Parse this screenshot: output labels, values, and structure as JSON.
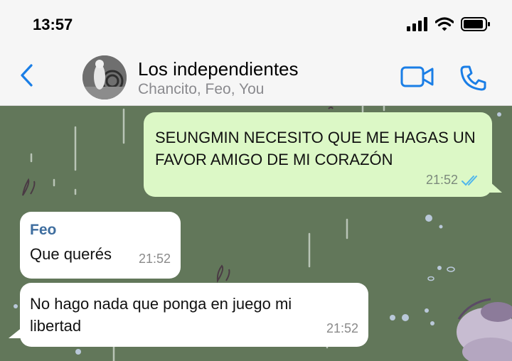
{
  "status": {
    "time": "13:57"
  },
  "header": {
    "back_icon": "chevron-left-icon",
    "group_name": "Los independientes",
    "members": "Chancito, Feo, You",
    "video_icon": "video-camera-icon",
    "call_icon": "phone-icon",
    "accent": "#1a7ee6"
  },
  "messages": [
    {
      "direction": "outgoing",
      "text": "SEUNGMIN NECESITO QUE ME HAGAS UN FAVOR AMIGO DE MI CORAZÓN",
      "time": "21:52",
      "status_icon": "double-check-icon"
    },
    {
      "direction": "incoming",
      "sender": "Feo",
      "text": "Que querés",
      "time": "21:52"
    },
    {
      "direction": "incoming",
      "text": "No hago nada que ponga en juego mi libertad",
      "time": "21:52"
    }
  ],
  "colors": {
    "chat_bg": "#62775a",
    "outgoing_bubble": "#dcf8c6",
    "incoming_bubble": "#ffffff",
    "sender_name": "#3f6e9f"
  }
}
